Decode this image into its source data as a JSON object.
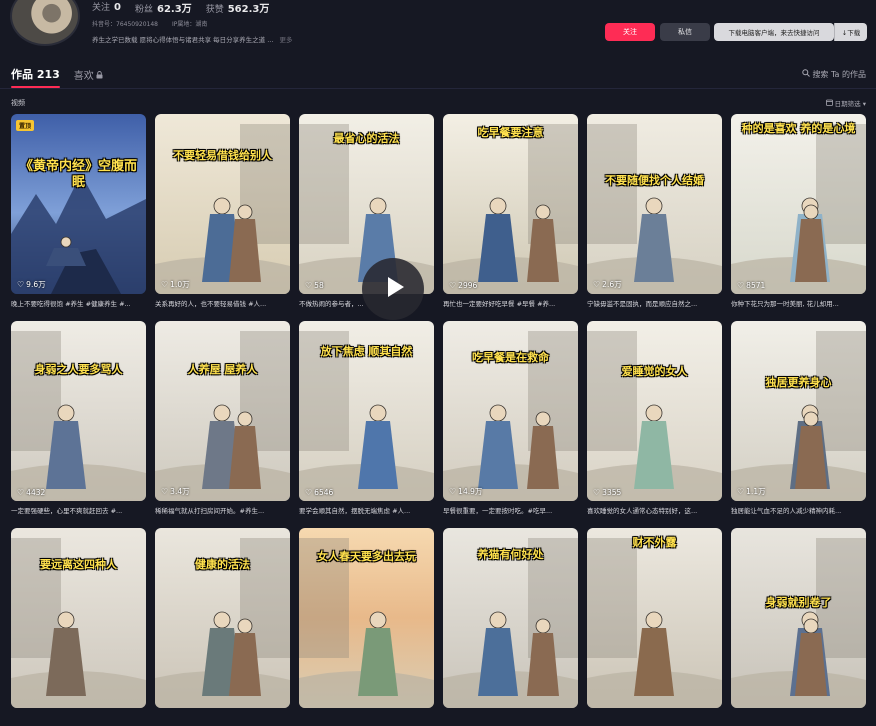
{
  "profile": {
    "stats": [
      {
        "label": "关注",
        "value": "0"
      },
      {
        "label": "粉丝",
        "value": "62.3万"
      },
      {
        "label": "获赞",
        "value": "562.3万"
      }
    ],
    "douyin_id": "抖音号：76450920148",
    "ip_location": "IP属地：湖南",
    "bio": "养生之学已数载 愿将心得体悟与诸君共享 每日分享养生之道 ...",
    "bio_more": "更多",
    "follow_label": "关注",
    "message_label": "私信",
    "app_prompt": "下载电脑客户端，来去快捷访问",
    "download_label": "↓下载"
  },
  "tabs": {
    "works_label": "作品 213",
    "likes_label": "喜欢",
    "search_label": "搜索 Ta 的作品"
  },
  "subbar": {
    "video_label": "视频",
    "filter_label": "日期筛选"
  },
  "pinned_label": "置顶",
  "videos": [
    {
      "overlay": "《黄帝内经》空腹而眠",
      "likes": "9.6万",
      "title": "晚上不要吃得很饱 #养生 #健康养生 #..."
    },
    {
      "overlay": "不要轻易借钱给别人",
      "likes": "1.0万",
      "title": "关系再好的人，也不要轻易借钱 #人..."
    },
    {
      "overlay": "最省心的活法",
      "likes": "58",
      "title": "不做热闹的参与者，..."
    },
    {
      "overlay": "吃早餐要注意",
      "likes": "2996",
      "title": "再忙也一定要好好吃早餐 #早餐 #养..."
    },
    {
      "overlay": "不要随便找个人结婚",
      "likes": "2.6万",
      "title": "宁缺毋滥不是固执，而是顺应自然之..."
    },
    {
      "overlay": "种的是喜欢 养的是心境",
      "likes": "8571",
      "title": "你种下花只为那一时美丽, 花儿却用..."
    },
    {
      "overlay": "身弱之人要多骂人",
      "likes": "4432",
      "title": "一定要强硬些，心里不爽就赶回去 #..."
    },
    {
      "overlay": "人养屋 屋养人",
      "likes": "3.4万",
      "title": "稀稀福气就从打扫房间开始。#养生..."
    },
    {
      "overlay": "放下焦虑 顺其自然",
      "likes": "6546",
      "title": "要学会顺其自然，摆脱无端焦虑 #人..."
    },
    {
      "overlay": "吃早餐是在救命",
      "likes": "14.9万",
      "title": "早餐很重要，一定要按时吃。#吃早..."
    },
    {
      "overlay": "爱睡觉的女人",
      "likes": "3355",
      "title": "喜欢睡觉的女人通常心态特别好，这..."
    },
    {
      "overlay": "独居更养身心",
      "likes": "1.1万",
      "title": "独居能让气血不足的人减少精神内耗..."
    },
    {
      "overlay": "要远离这四种人",
      "likes": "",
      "title": ""
    },
    {
      "overlay": "健康的活法",
      "likes": "",
      "title": ""
    },
    {
      "overlay": "女人春天要多出去玩",
      "likes": "",
      "title": ""
    },
    {
      "overlay": "养猫有何好处",
      "likes": "",
      "title": ""
    },
    {
      "overlay": "财不外露",
      "likes": "",
      "title": ""
    },
    {
      "overlay": "身弱就别卷了",
      "likes": "",
      "title": ""
    }
  ],
  "colors": {
    "background": "#161823",
    "accent": "#fe2c55",
    "overlay_text": "#ffe14d"
  }
}
